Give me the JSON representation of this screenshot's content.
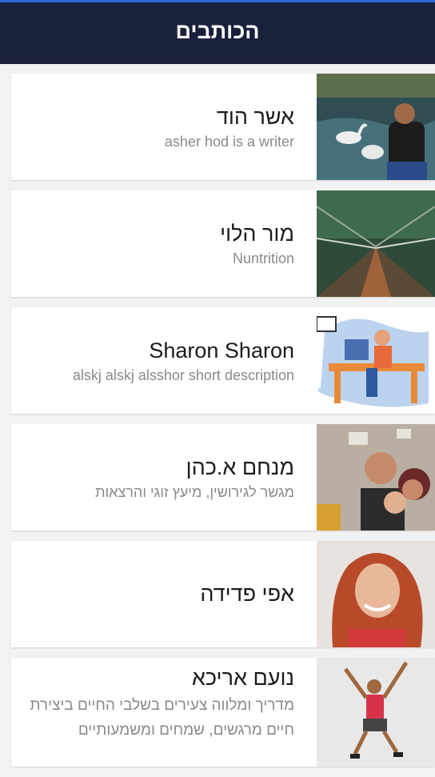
{
  "header": {
    "title": "הכותבים"
  },
  "writers": [
    {
      "name": "אשר הוד",
      "description": "asher hod is a writer"
    },
    {
      "name": "מור הלוי",
      "description": "Nuntrition"
    },
    {
      "name": "Sharon Sharon",
      "description": "alskj alskj alsshor short description"
    },
    {
      "name": "מנחם א.כהן",
      "description": "מגשר לגירושין, מיעץ זוגי והרצאות"
    },
    {
      "name": "אפי פדידה",
      "description": ""
    },
    {
      "name": "נועם אריכא",
      "description": "מדריך ומלווה צעירים בשלבי החיים ביצירת חיים מרגשים, שמחים ומשמעותיים"
    }
  ],
  "colors": {
    "header_bg": "#19203c",
    "header_accent": "#2d6bd6",
    "page_bg": "#f2f2f2"
  }
}
